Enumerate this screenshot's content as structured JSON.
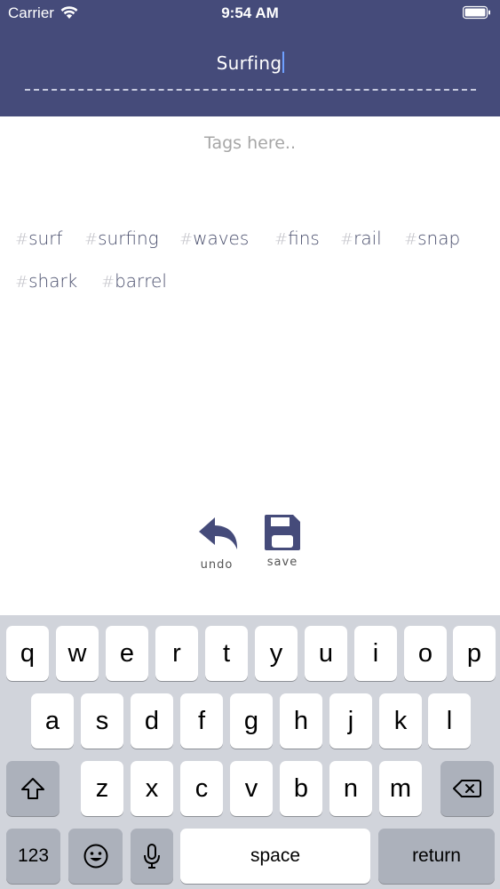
{
  "status_bar": {
    "carrier": "Carrier",
    "time": "9:54 AM",
    "wifi_icon": "wifi-icon",
    "battery_icon": "battery-icon"
  },
  "header": {
    "title_value": "Surfing",
    "background_color": "#454b7a"
  },
  "tags_input": {
    "placeholder": "Tags here.."
  },
  "tags": [
    {
      "hash": "#",
      "label": "surf"
    },
    {
      "hash": "#",
      "label": "surfing"
    },
    {
      "hash": "#",
      "label": "waves"
    },
    {
      "hash": "#",
      "label": "fins"
    },
    {
      "hash": "#",
      "label": "rail"
    },
    {
      "hash": "#",
      "label": "snap"
    },
    {
      "hash": "#",
      "label": "shark"
    },
    {
      "hash": "#",
      "label": "barrel"
    }
  ],
  "actions": {
    "undo_label": "undo",
    "undo_icon": "undo-arrow-icon",
    "save_label": "save",
    "save_icon": "floppy-disk-icon"
  },
  "keyboard": {
    "row1": [
      "q",
      "w",
      "e",
      "r",
      "t",
      "y",
      "u",
      "i",
      "o",
      "p"
    ],
    "row2": [
      "a",
      "s",
      "d",
      "f",
      "g",
      "h",
      "j",
      "k",
      "l"
    ],
    "row3": [
      "z",
      "x",
      "c",
      "v",
      "b",
      "n",
      "m"
    ],
    "shift_icon": "shift-icon",
    "delete_icon": "backspace-icon",
    "numbers_label": "123",
    "emoji_icon": "emoji-icon",
    "mic_icon": "microphone-icon",
    "space_label": "space",
    "return_label": "return"
  }
}
